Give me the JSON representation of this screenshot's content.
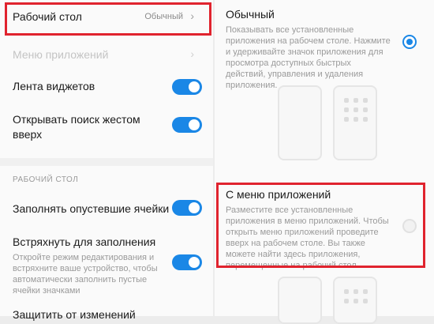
{
  "left": {
    "desktop": {
      "label": "Рабочий стол",
      "value": "Обычный"
    },
    "app_menu": {
      "label": "Меню приложений"
    },
    "widgets": {
      "label": "Лента виджетов",
      "enabled": true
    },
    "search_gesture": {
      "label": "Открывать поиск жестом вверх",
      "enabled": true
    },
    "section_header": "РАБОЧИЙ СТОЛ",
    "fill_cells": {
      "label": "Заполнять опустевшие ячейки",
      "enabled": true
    },
    "shake": {
      "label": "Встряхнуть для заполнения",
      "sub": "Откройте режим редактирования и встряхните ваше устройство, чтобы автоматически заполнить пустые ячейки значками",
      "enabled": true
    },
    "protect": {
      "label": "Защитить от изменений"
    }
  },
  "right": {
    "option1": {
      "title": "Обычный",
      "desc": "Показывать все установленные приложения на рабочем столе. Нажмите и удерживайте значок приложения для просмотра доступных быстрых действий, управления и удаления приложения.",
      "selected": true
    },
    "option2": {
      "title": "С меню приложений",
      "desc": "Разместите все установленные приложения в меню приложений. Чтобы открыть меню приложений проведите вверх на рабочем столе. Вы также можете найти здесь приложения, перемещенные на рабочий стол.",
      "selected": false
    }
  },
  "colors": {
    "accent": "#1a87e6",
    "highlight": "#e0232e"
  },
  "icons": {
    "chevron": "chevron-right-icon"
  }
}
